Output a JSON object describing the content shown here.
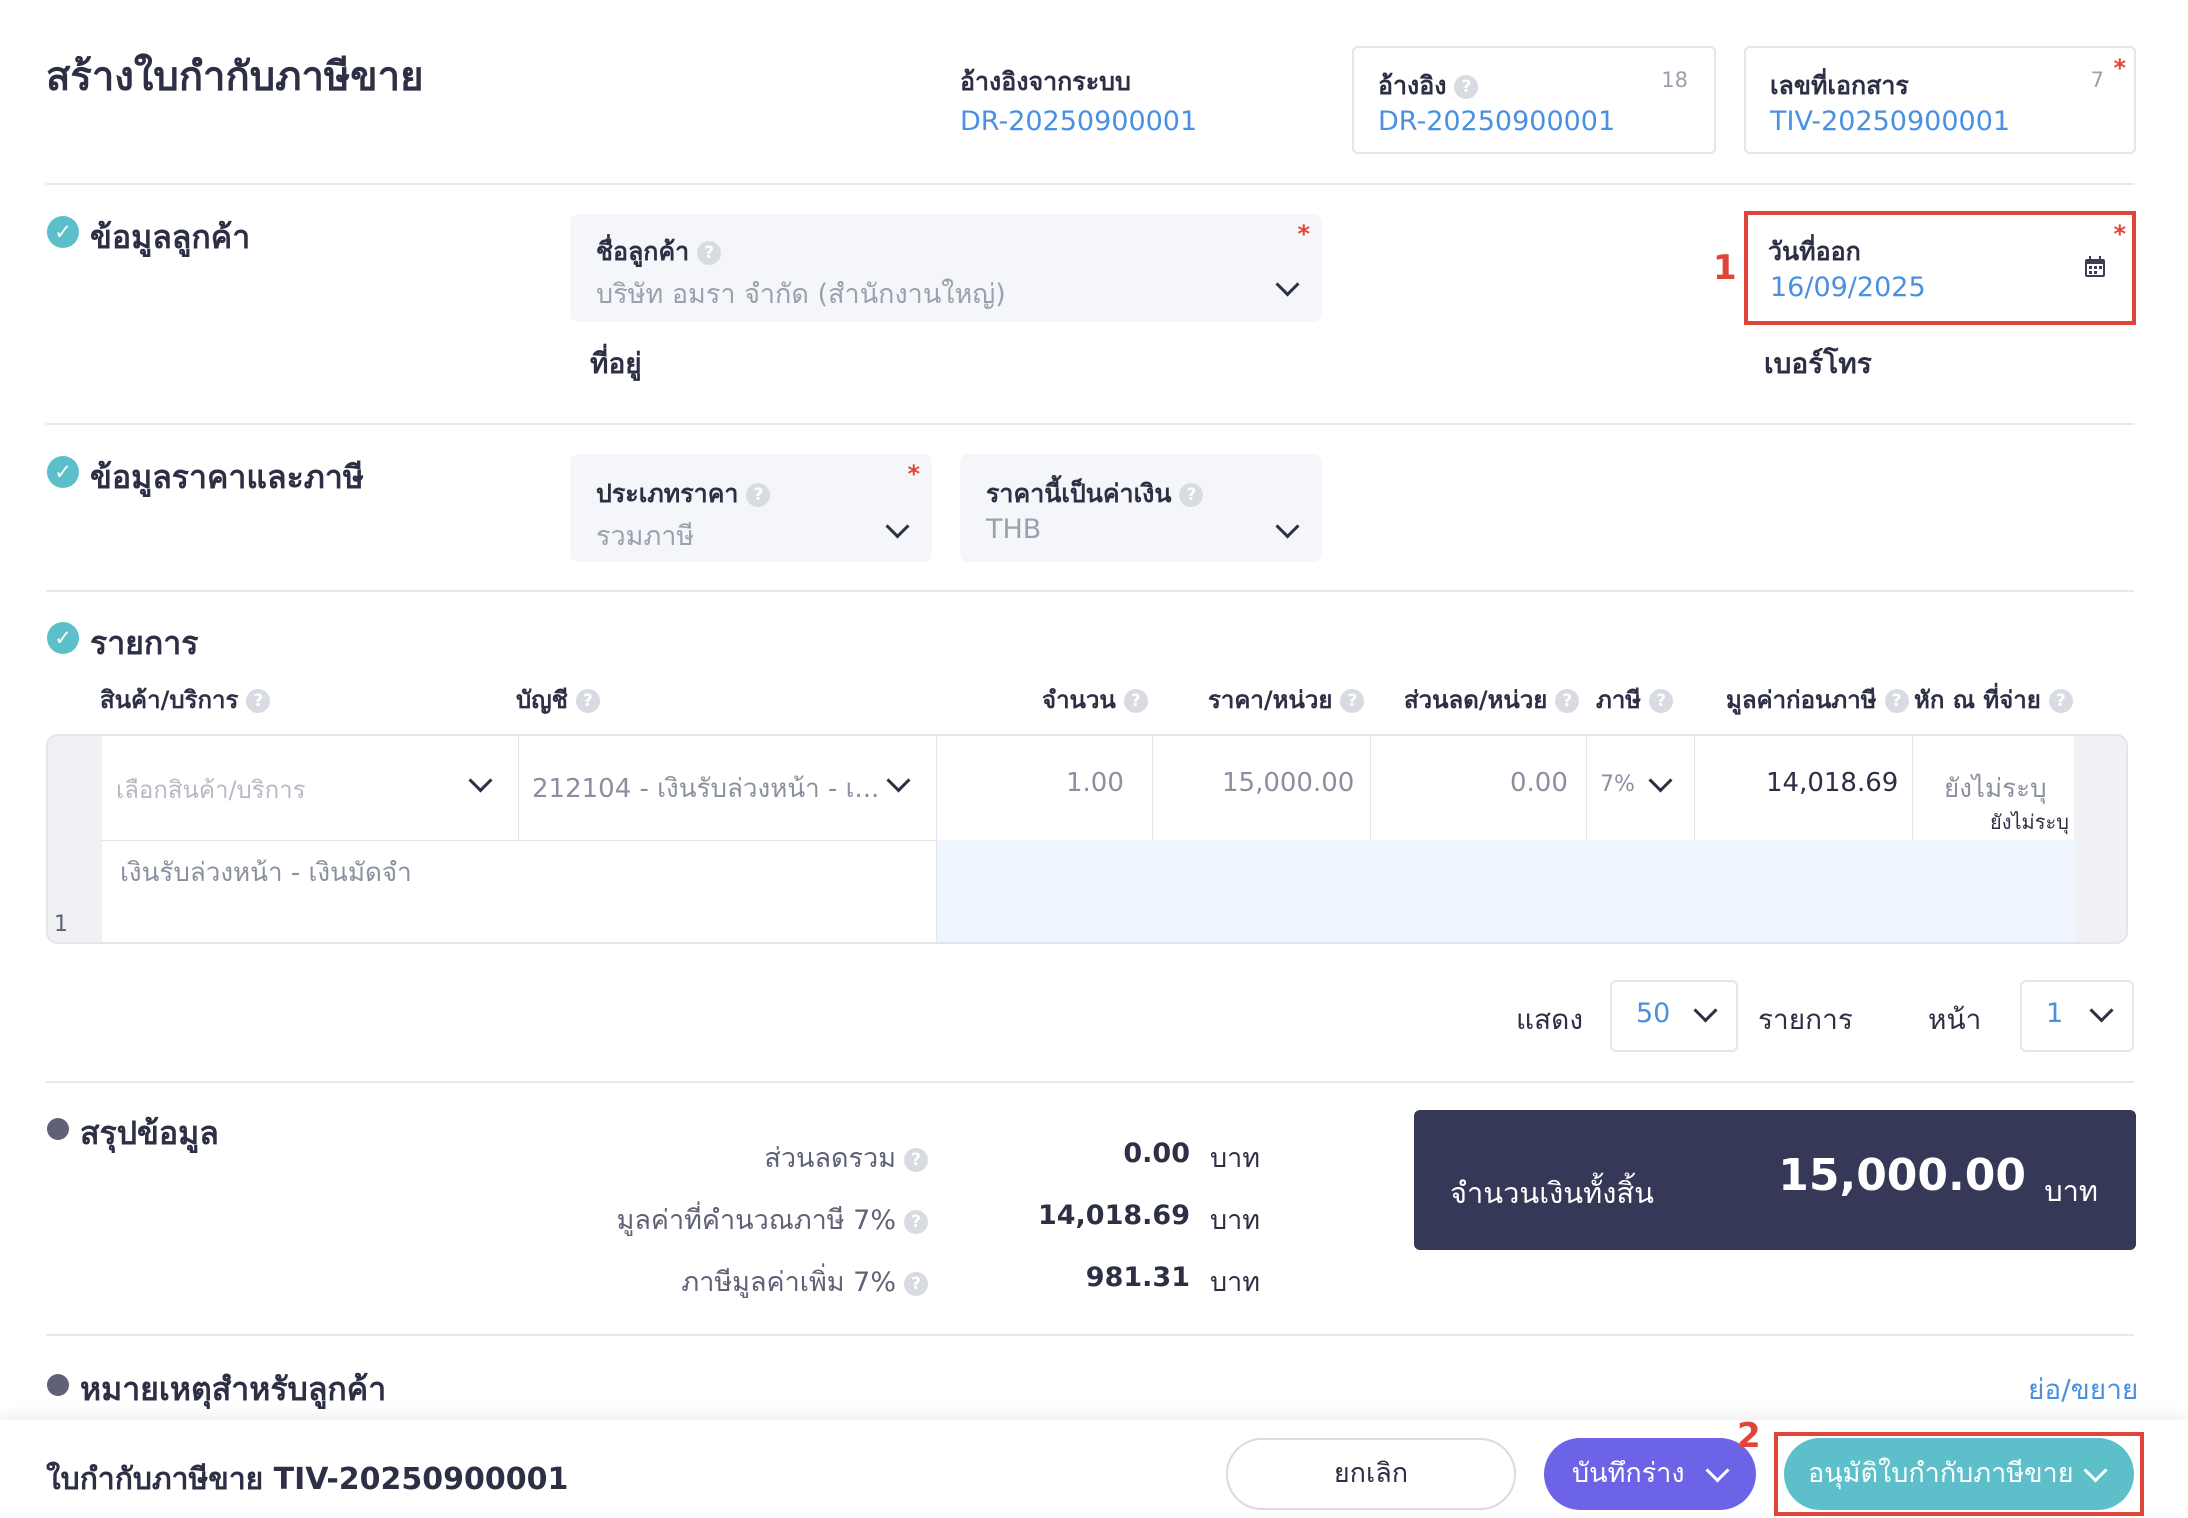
{
  "header": {
    "title": "สร้างใบกำกับภาษีขาย",
    "system_ref_label": "อ้างอิงจากระบบ",
    "system_ref_value": "DR-20250900001",
    "ref_label": "อ้างอิง",
    "ref_value": "DR-20250900001",
    "ref_counter": "18",
    "docno_label": "เลขที่เอกสาร",
    "docno_value": "TIV-20250900001",
    "docno_counter": "7"
  },
  "customer_section": {
    "title": "ข้อมูลลูกค้า",
    "customer_label": "ชื่อลูกค้า",
    "customer_value": "บริษัท อมรา จำกัด (สำนักงานใหญ่)",
    "address_label": "ที่อยู่",
    "issue_date_label": "วันที่ออก",
    "issue_date_value": "16/09/2025",
    "phone_label": "เบอร์โทร"
  },
  "price_section": {
    "title": "ข้อมูลราคาและภาษี",
    "price_type_label": "ประเภทราคา",
    "price_type_value": "รวมภาษี",
    "currency_label": "ราคานี้เป็นค่าเงิน",
    "currency_value": "THB"
  },
  "items_section": {
    "title": "รายการ",
    "columns": [
      "สินค้า/บริการ",
      "บัญชี",
      "จำนวน",
      "ราคา/หน่วย",
      "ส่วนลด/หน่วย",
      "ภาษี",
      "มูลค่าก่อนภาษี",
      "หัก ณ ที่จ่าย"
    ],
    "rows": [
      {
        "index": "1",
        "product_placeholder": "เลือกสินค้า/บริการ",
        "account": "212104 - เงินรับล่วงหน้า - เ...",
        "qty": "1.00",
        "unit_price": "15,000.00",
        "discount": "0.00",
        "tax": "7%",
        "pre_tax": "14,018.69",
        "withholding": "ยังไม่ระบุ",
        "withholding_sub": "ยังไม่ระบุ",
        "description": "เงินรับล่วงหน้า - เงินมัดจำ"
      }
    ]
  },
  "pagination": {
    "show_label": "แสดง",
    "per_page": "50",
    "items_label": "รายการ",
    "page_label": "หน้า",
    "page": "1"
  },
  "summary": {
    "title": "สรุปข้อมูล",
    "discount_label": "ส่วนลดรวม",
    "discount_value": "0.00",
    "taxable_label": "มูลค่าที่คำนวณภาษี 7%",
    "taxable_value": "14,018.69",
    "vat_label": "ภาษีมูลค่าเพิ่ม 7%",
    "vat_value": "981.31",
    "unit": "บาท",
    "total_label": "จำนวนเงินทั้งสิ้น",
    "total_value": "15,000.00",
    "total_unit": "บาท"
  },
  "notes": {
    "title": "หมายเหตุสำหรับลูกค้า",
    "toggle": "ย่อ/ขยาย"
  },
  "footer": {
    "doc_title": "ใบกำกับภาษีขาย TIV-20250900001",
    "cancel": "ยกเลิก",
    "save_draft": "บันทึกร่าง",
    "approve": "อนุมัติใบกำกับภาษีขาย"
  },
  "annotations": {
    "marker_1": "1",
    "marker_2": "2"
  },
  "colors": {
    "accent_blue": "#4a90e2",
    "teal": "#5cbfc9",
    "purple": "#6c63e6",
    "navy_total": "#363857",
    "annotation_red": "#e0453a"
  }
}
